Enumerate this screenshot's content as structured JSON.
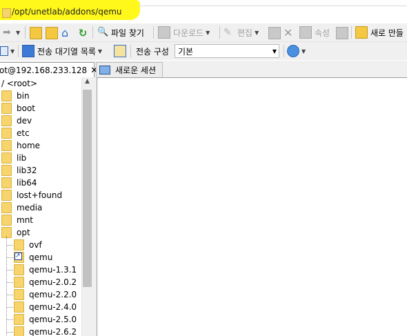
{
  "path_bar": {
    "path": "/opt/unetlab/addons/qemu"
  },
  "toolbar": {
    "find_files": "파일 찾기",
    "download": "다운로드",
    "edit": "편집",
    "properties": "속성",
    "new": "새로 만들"
  },
  "toolbar2": {
    "transfer_queue": "전송 대기열 목록",
    "transfer_settings": "전송 구성",
    "transfer_settings_value": "기본"
  },
  "tabs": {
    "session": "ot@192.168.233.128",
    "new_session": "새로운 세션"
  },
  "tree": {
    "root": "/ <root>",
    "items": [
      "bin",
      "boot",
      "dev",
      "etc",
      "home",
      "lib",
      "lib32",
      "lib64",
      "lost+found",
      "media",
      "mnt",
      "opt"
    ],
    "opt_children": [
      "ovf",
      "qemu",
      "qemu-1.3.1",
      "qemu-2.0.2",
      "qemu-2.2.0",
      "qemu-2.4.0",
      "qemu-2.5.0",
      "qemu-2.6.2"
    ]
  },
  "colors": {
    "highlight": "#fff81a",
    "folder": "#f7d56c",
    "refresh": "#2e9d2e"
  }
}
